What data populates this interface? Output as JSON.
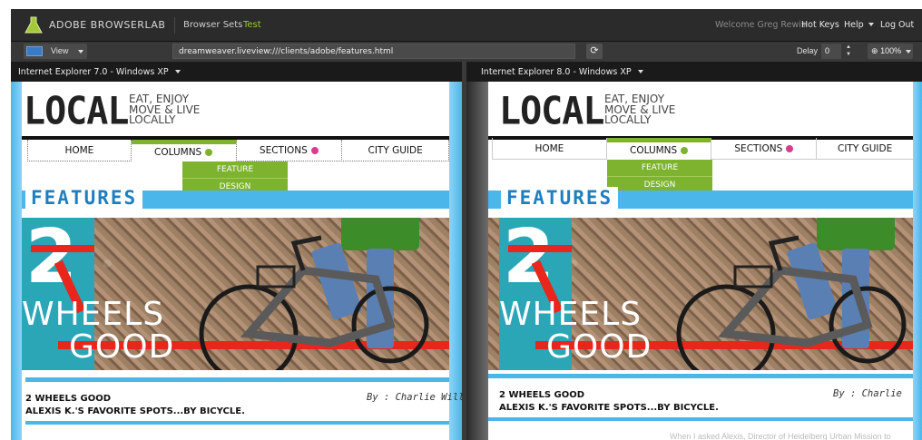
{
  "app": {
    "logo_text": "ADOBE  BROWSERLAB",
    "browser_sets": "Browser Sets",
    "set_name": "Test",
    "welcome": "Welcome Greg Rewis",
    "hot_keys": "Hot Keys",
    "help": "Help",
    "log_out": "Log Out"
  },
  "toolbar": {
    "view_label": "View",
    "url": "dreamweaver.liveview:///clients/adobe/features.html",
    "refresh_icon": "refresh-icon",
    "delay_label": "Delay",
    "delay_value": "0",
    "zoom_value": "100%"
  },
  "panes": {
    "left_title": "Internet Explorer 7.0 - Windows XP",
    "right_title": "Internet Explorer 8.0 - Windows XP"
  },
  "site": {
    "logo": "LOCAL",
    "tagline": [
      "EAT, ENJOY",
      "MOVE & LIVE",
      "LOCALLY"
    ],
    "nav": [
      "HOME",
      "COLUMNS",
      "SECTIONS",
      "CITY GUIDE"
    ],
    "dropdown": [
      "FEATURE",
      "DESIGN"
    ],
    "features_heading": "FEATURES",
    "hero_number": "2",
    "hero_line1": "WHEELS",
    "hero_line2": "GOOD",
    "story_title": "2 WHEELS GOOD",
    "story_sub": "ALEXIS K.'S FAVORITE SPOTS...BY BICYCLE.",
    "byline_left": "By : Charlie Will",
    "byline_right": "By : Charlie",
    "faint_teaser": "When I asked Alexis, Director of Heidelberg Urban Mission to"
  },
  "colors": {
    "accent_green": "#7db32e",
    "accent_pink": "#d43e8c",
    "brand_blue": "#4ab6ea",
    "toolbar_dark": "#2b2b2b",
    "hero_red": "#e8261c"
  }
}
